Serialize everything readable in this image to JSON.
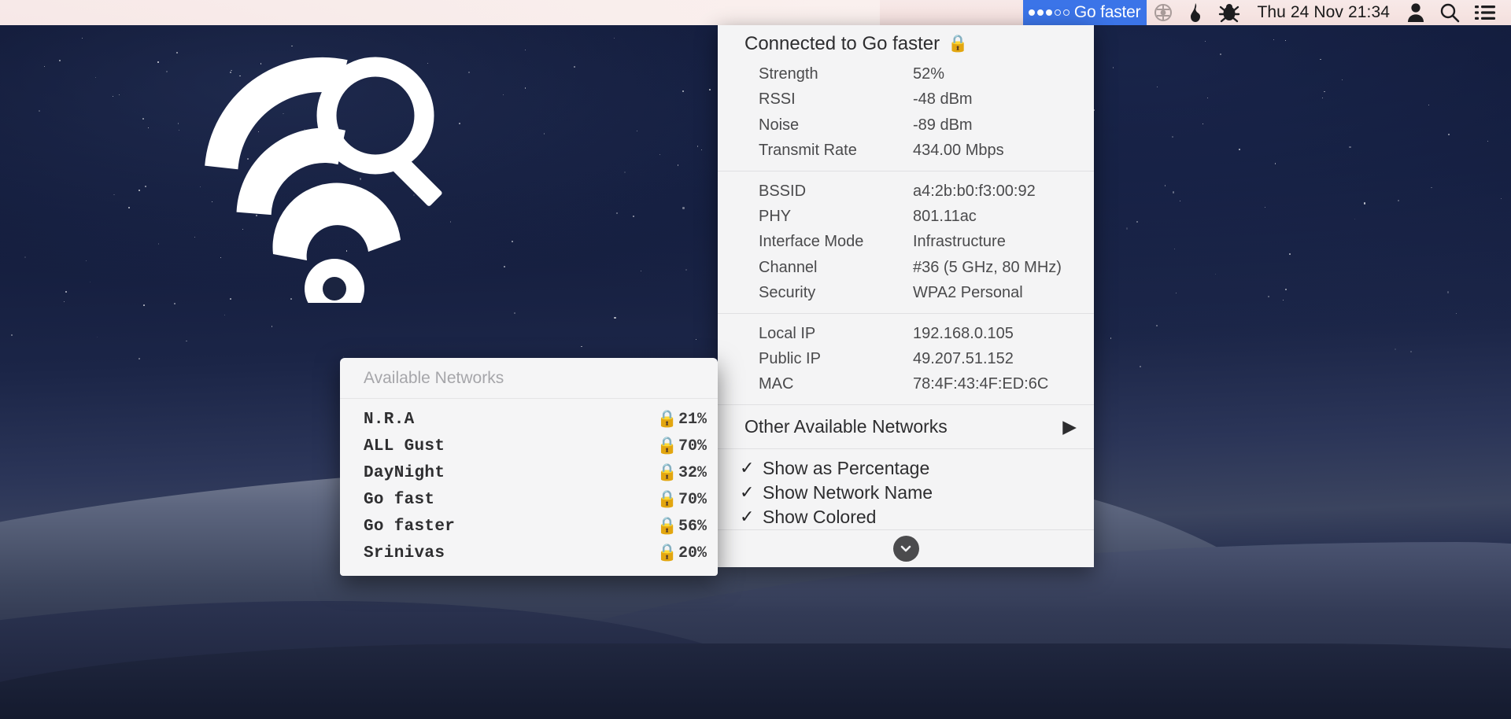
{
  "menubar": {
    "wifi": {
      "network_name": "Go faster",
      "signal_dots_filled": 3,
      "signal_dots_total": 5,
      "highlight_color": "#3b74e8"
    },
    "icons": [
      "deluge-icon",
      "flame-icon",
      "bug-icon"
    ],
    "clock": "Thu 24 Nov  21:34",
    "right_icons": [
      "user-icon",
      "search-icon",
      "notification-center-icon"
    ]
  },
  "wifi_panel": {
    "title": "Connected to Go faster",
    "title_lock_icon": "lock-icon",
    "connection": [
      {
        "label": "Strength",
        "value": "52%"
      },
      {
        "label": "RSSI",
        "value": "-48 dBm"
      },
      {
        "label": "Noise",
        "value": "-89 dBm"
      },
      {
        "label": "Transmit Rate",
        "value": "434.00 Mbps"
      }
    ],
    "radio": [
      {
        "label": "BSSID",
        "value": "a4:2b:b0:f3:00:92"
      },
      {
        "label": "PHY",
        "value": "801.11ac"
      },
      {
        "label": "Interface Mode",
        "value": "Infrastructure"
      },
      {
        "label": "Channel",
        "value": "#36 (5 GHz, 80 MHz)"
      },
      {
        "label": "Security",
        "value": "WPA2 Personal"
      }
    ],
    "addresses": [
      {
        "label": "Local IP",
        "value": "192.168.0.105"
      },
      {
        "label": "Public IP",
        "value": "49.207.51.152"
      },
      {
        "label": "MAC",
        "value": "78:4F:43:4F:ED:6C"
      }
    ],
    "other_networks": {
      "label": "Other Available Networks",
      "arrow": "▶"
    },
    "options": [
      {
        "label": "Show as Percentage",
        "checked": true,
        "mark": "✓"
      },
      {
        "label": "Show Network Name",
        "checked": true,
        "mark": "✓"
      },
      {
        "label": "Show Colored",
        "checked": true,
        "mark": "✓"
      }
    ],
    "footer_button": "chevron-down-icon"
  },
  "networks_popup": {
    "header": "Available Networks",
    "lock_icon": "lock-icon",
    "rows": [
      {
        "name": "N.R.A",
        "pct": "21%"
      },
      {
        "name": "ALL Gust",
        "pct": "70%"
      },
      {
        "name": "DayNight",
        "pct": "32%"
      },
      {
        "name": "Go fast",
        "pct": "70%"
      },
      {
        "name": "Go faster",
        "pct": "56%"
      },
      {
        "name": "Srinivas",
        "pct": "20%"
      }
    ]
  },
  "desktop": {
    "app_logo": "wifi-magnifier-logo"
  }
}
